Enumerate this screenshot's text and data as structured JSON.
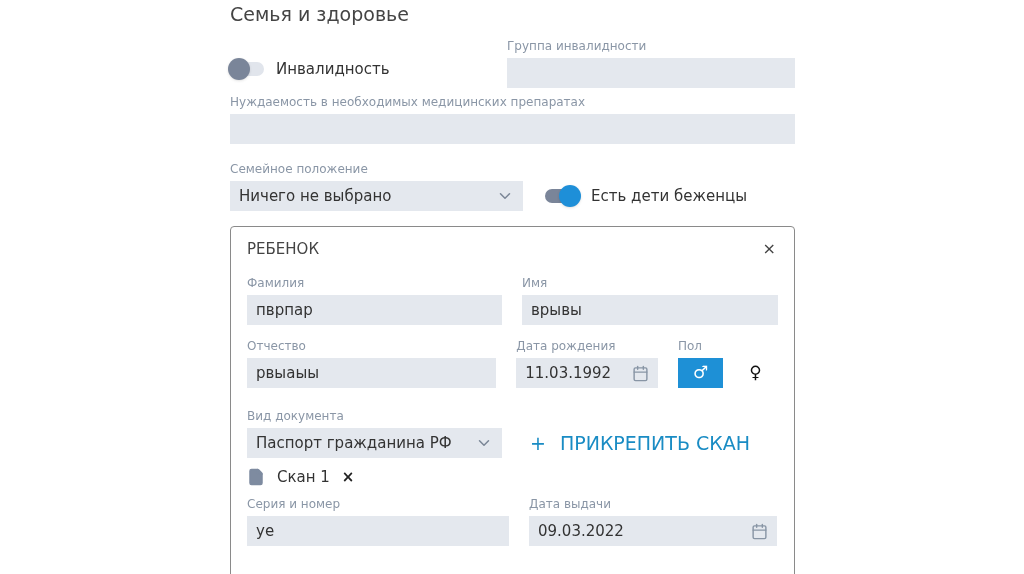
{
  "section_title": "Семья и здоровье",
  "disability": {
    "label": "Инвалидность",
    "on": false
  },
  "disability_group": {
    "label": "Группа инвалидности"
  },
  "medicine_need": {
    "label": "Нуждаемость в необходимых медицинских препаратах"
  },
  "marital_status": {
    "label": "Семейное положение",
    "value": "Ничего не выбрано"
  },
  "refugee_children": {
    "label": "Есть дети беженцы",
    "on": true
  },
  "child_card": {
    "title": "РЕБЕНОК",
    "close": "×",
    "last_name": {
      "label": "Фамилия",
      "value": "пврпар"
    },
    "first_name": {
      "label": "Имя",
      "value": "врывы"
    },
    "patronymic": {
      "label": "Отчество",
      "value": "рвыаыы"
    },
    "birth_date": {
      "label": "Дата рождения",
      "value": "11.03.1992"
    },
    "sex": {
      "label": "Пол",
      "options": [
        {
          "symbol": "♂",
          "selected": true
        },
        {
          "symbol": "♀",
          "selected": false
        }
      ]
    },
    "document_type": {
      "label": "Вид документа",
      "value": "Паспорт гражданина РФ"
    },
    "attach_button": {
      "plus": "+",
      "label": "ПРИКРЕПИТЬ СКАН"
    },
    "scans": [
      {
        "name": "Скан 1",
        "remove": "×"
      }
    ],
    "series_number": {
      "label": "Серия и номер",
      "value": "уе"
    },
    "issue_date": {
      "label": "Дата выдачи",
      "value": "09.03.2022"
    }
  }
}
